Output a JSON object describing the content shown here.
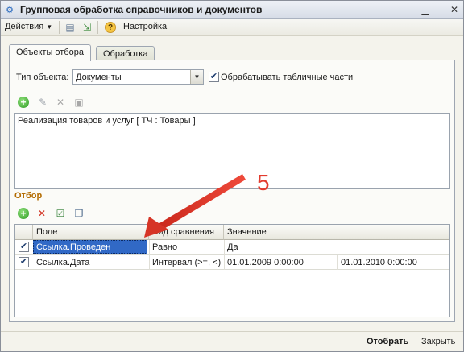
{
  "window": {
    "title": "Групповая обработка справочников и документов"
  },
  "cmdbar": {
    "actions_label": "Действия",
    "settings_label": "Настройка"
  },
  "tabs": [
    {
      "label": "Объекты отбора"
    },
    {
      "label": "Обработка"
    }
  ],
  "form": {
    "object_type_label": "Тип объекта:",
    "object_type_value": "Документы",
    "process_tables_label": "Обрабатывать табличные части",
    "process_tables_checked": true
  },
  "objects_list": [
    {
      "text": "Реализация товаров и услуг [ ТЧ : Товары ]"
    }
  ],
  "filter": {
    "group_label": "Отбор",
    "columns": [
      "Поле",
      "Вид сравнения",
      "Значение"
    ],
    "rows": [
      {
        "checked": true,
        "field": "Ссылка.Проведен",
        "comparison": "Равно",
        "value": "Да",
        "value2": ""
      },
      {
        "checked": true,
        "field": "Ссылка.Дата",
        "comparison": "Интервал (>=, <)",
        "value": "01.01.2009 0:00:00",
        "value2": "01.01.2010 0:00:00"
      }
    ]
  },
  "annotation": {
    "number": "5",
    "color": "#e23b2e"
  },
  "bottom": {
    "select_label": "Отобрать",
    "close_label": "Закрыть"
  },
  "icons": {
    "window": "processing-icon",
    "minimize": "minimize-icon",
    "close": "close-icon",
    "add": "add-icon",
    "edit": "edit-icon",
    "delete": "delete-icon",
    "save": "save-icon",
    "check_all": "check-all-icon",
    "uncheck_all": "uncheck-all-icon"
  }
}
